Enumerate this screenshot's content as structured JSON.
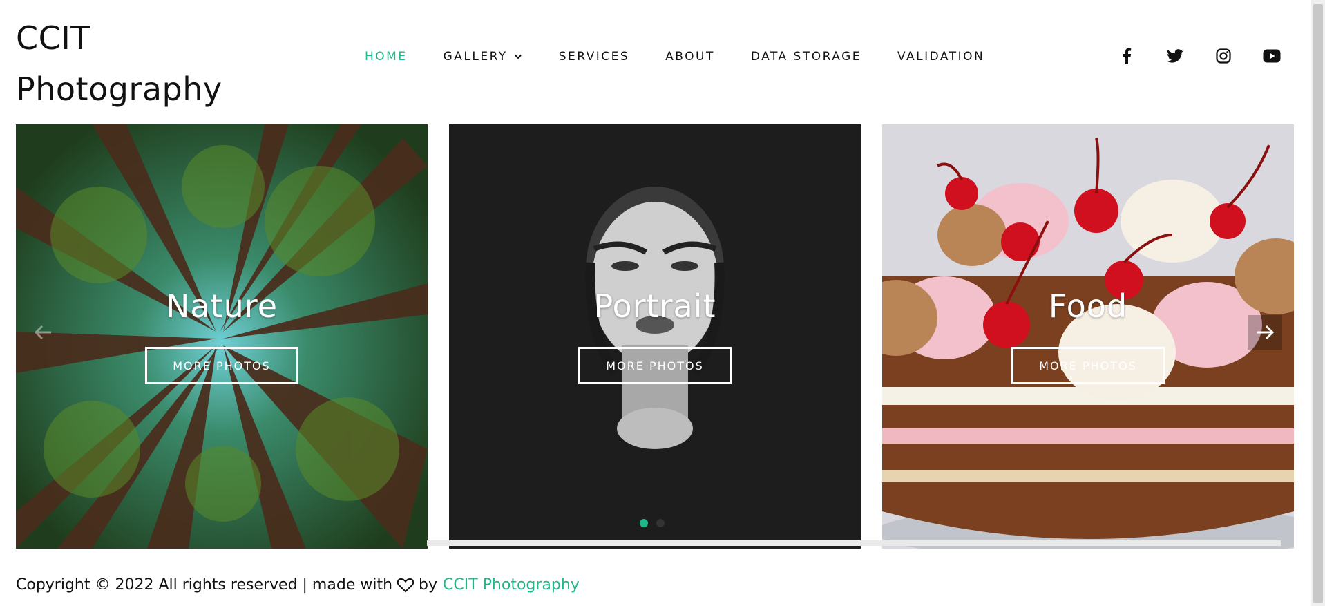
{
  "brand": {
    "line1": "CCIT",
    "line2": "Photography"
  },
  "nav": {
    "items": [
      {
        "label": "HOME",
        "active": true
      },
      {
        "label": "GALLERY",
        "dropdown": true
      },
      {
        "label": "SERVICES"
      },
      {
        "label": "ABOUT"
      },
      {
        "label": "DATA STORAGE"
      },
      {
        "label": "VALIDATION"
      }
    ]
  },
  "social": [
    "facebook-icon",
    "twitter-icon",
    "instagram-icon",
    "youtube-icon"
  ],
  "gallery": {
    "cards": [
      {
        "title": "Nature",
        "button": "MORE PHOTOS"
      },
      {
        "title": "Portrait",
        "button": "MORE PHOTOS"
      },
      {
        "title": "Food",
        "button": "MORE PHOTOS"
      }
    ],
    "dots": 2,
    "active_dot": 0
  },
  "footer": {
    "text": "Copyright © 2022 All rights reserved | made with",
    "by": "by",
    "link": "CCIT Photography"
  },
  "colors": {
    "accent": "#1fb88b",
    "text": "#111111"
  }
}
